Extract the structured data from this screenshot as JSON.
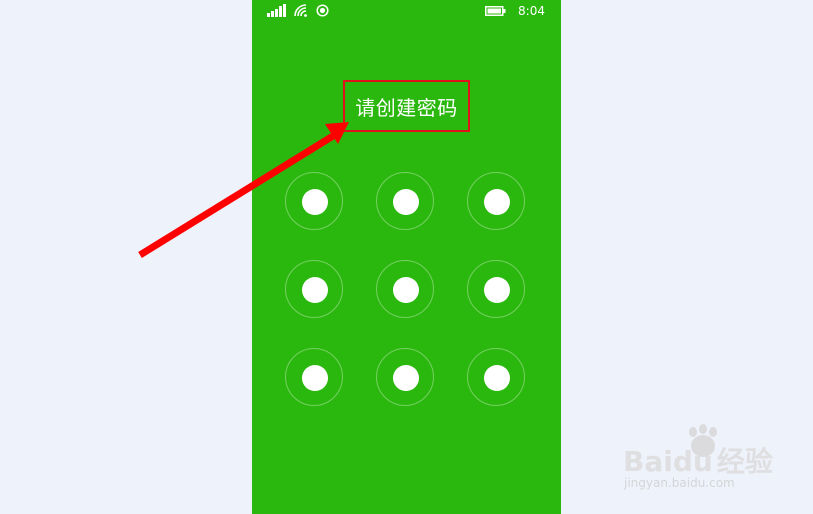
{
  "status_bar": {
    "time": "8:04",
    "icons": [
      "signal-bars-icon",
      "wifi-icon",
      "location-icon",
      "battery-icon"
    ]
  },
  "screen": {
    "title": "请创建密码",
    "background": "#2bb80e",
    "pattern_dot_count": 9
  },
  "annotation": {
    "highlight_color": "#e0111b",
    "arrow_color": "#ff0000"
  },
  "watermark": {
    "brand": "Bai",
    "brand_tail": "du",
    "brand_cn": "经验",
    "url": "jingyan.baidu.com"
  }
}
